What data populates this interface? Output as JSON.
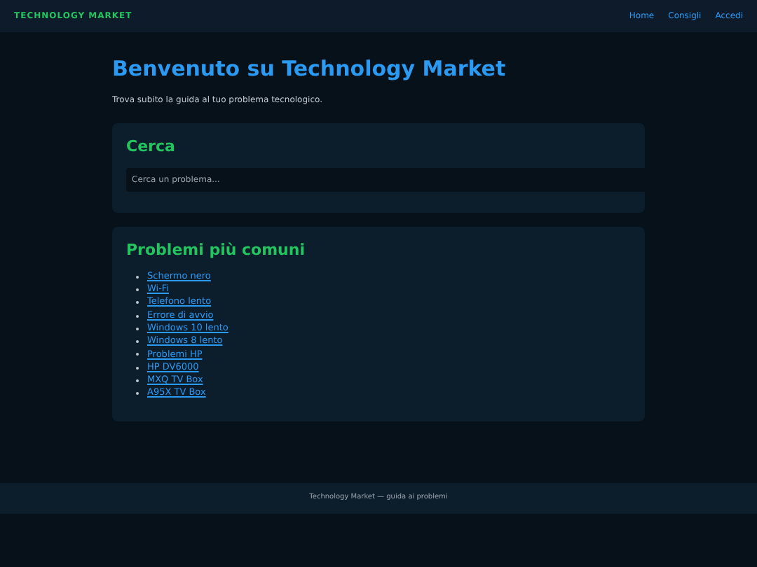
{
  "header": {
    "brand": "TECHNOLOGY MARKET",
    "nav": [
      "Home",
      "Consigli",
      "Accedi"
    ]
  },
  "hero": {
    "title": "Benvenuto su Technology Market",
    "subtitle": "Trova subito la guida al tuo problema tecnologico."
  },
  "search_card": {
    "title": "Cerca",
    "placeholder": "Cerca un problema..."
  },
  "problems_card": {
    "title": "Problemi più comuni",
    "links": [
      "Schermo nero",
      "Wi-Fi",
      "Telefono lento",
      "Errore di avvio",
      "Windows 10 lento",
      "Windows 8 lento",
      "Problemi HP",
      "HP DV6000",
      "MXQ TV Box",
      "A95X TV Box"
    ]
  },
  "footer": "Technology Market — guida ai problemi"
}
